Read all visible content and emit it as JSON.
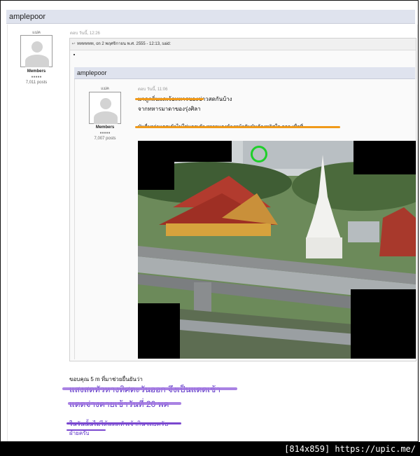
{
  "outer_post": {
    "username": "amplepoor",
    "user_meta": "แม่ค",
    "group": "Members",
    "stars": "●●●●●",
    "posts": "7,011 posts",
    "posted": "ตอบ วันนี้, 12:26"
  },
  "quote": {
    "header": "ทททททท, on 2 พฤศจิกายน พ.ศ. 2555 - 12:13, said:"
  },
  "inner_post": {
    "username": "amplepoor",
    "user_meta": "แม่ค",
    "group": "Members",
    "stars": "●●●●●",
    "posts": "7,007 posts",
    "posted": "ตอบ วันนี้, 11:06",
    "line1": "มาดูกลิ่นแดเจ้อทหารของข่าวสดกันบ้าง",
    "line2": "จากทหารมาดาของรุ่งศิลา",
    "line3": "มันอื่มกว่าแดดเข้าไม่ใช่แดดเช้า ทรายแดงข้างหน้ายันมันต้องหอิศใจ ถอก เพื่อที่"
  },
  "reply": {
    "thanks": "ขอบคุณ 5 m ที่มาช่วยยื่นยันว่า",
    "scribble1": "แสงสดหัวหางทิศตะวันออก จึงเป็นแดดเช้า",
    "scribble2": "แดดจ่างคายเช้าวันที่ 20 พค",
    "scribble3": "ในวันนั้นไม่ได้แดดหัวเจ้ากิน เลยครับ",
    "scribble4": "ฝ่ายครับ"
  },
  "footer": {
    "text": "[814x859] https://upic.me/"
  },
  "colors": {
    "header_bg": "#dfe3ee",
    "strike_orange": "#f09a1a",
    "marker_purple": "#a074e0",
    "circle_green": "#1fcf2a"
  }
}
